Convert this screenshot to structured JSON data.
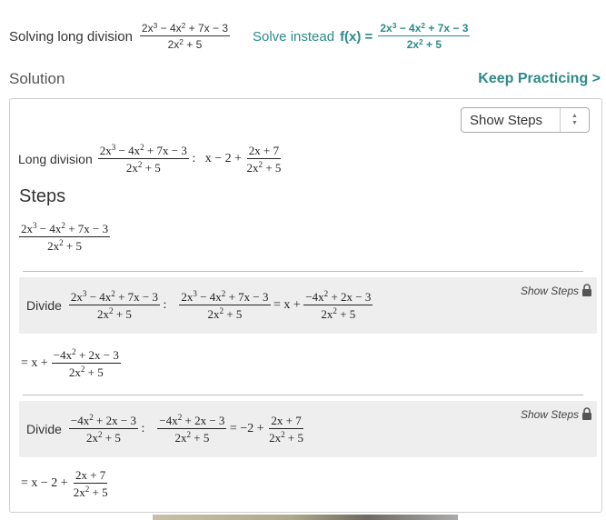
{
  "header": {
    "prefix": "Solving long division",
    "problem_num": [
      "2x",
      "3",
      " − 4x",
      "2",
      " + 7x − 3"
    ],
    "problem_den": [
      "2x",
      "2",
      " + 5"
    ],
    "solve_instead_label": "Solve instead",
    "solve_instead_fx": "f(x) ="
  },
  "solution_label": "Solution",
  "keep_practicing": "Keep Practicing >",
  "select": {
    "value": "Show Steps"
  },
  "long_division": {
    "label": "Long division",
    "result_a": "x − 2 +",
    "result_num": "2x + 7",
    "result_den_a": "2x",
    "result_den_sup": "2",
    "result_den_b": " + 5"
  },
  "steps_title": "Steps",
  "step1": {
    "divide_label": "Divide",
    "eq_rhs": "= x +",
    "rhs_num_a": "−4x",
    "rhs_num_sup": "2",
    "rhs_num_b": " + 2x − 3",
    "show_steps": "Show Steps"
  },
  "result1": {
    "lhs": "= x +"
  },
  "step2": {
    "divide_label": "Divide",
    "eq_rhs": "= −2 +",
    "rhs_num": "2x + 7",
    "show_steps": "Show Steps"
  },
  "result2": {
    "lhs": "= x − 2 +"
  },
  "colors": {
    "accent": "#2d8a8a",
    "step_bg": "#eeeeee"
  }
}
